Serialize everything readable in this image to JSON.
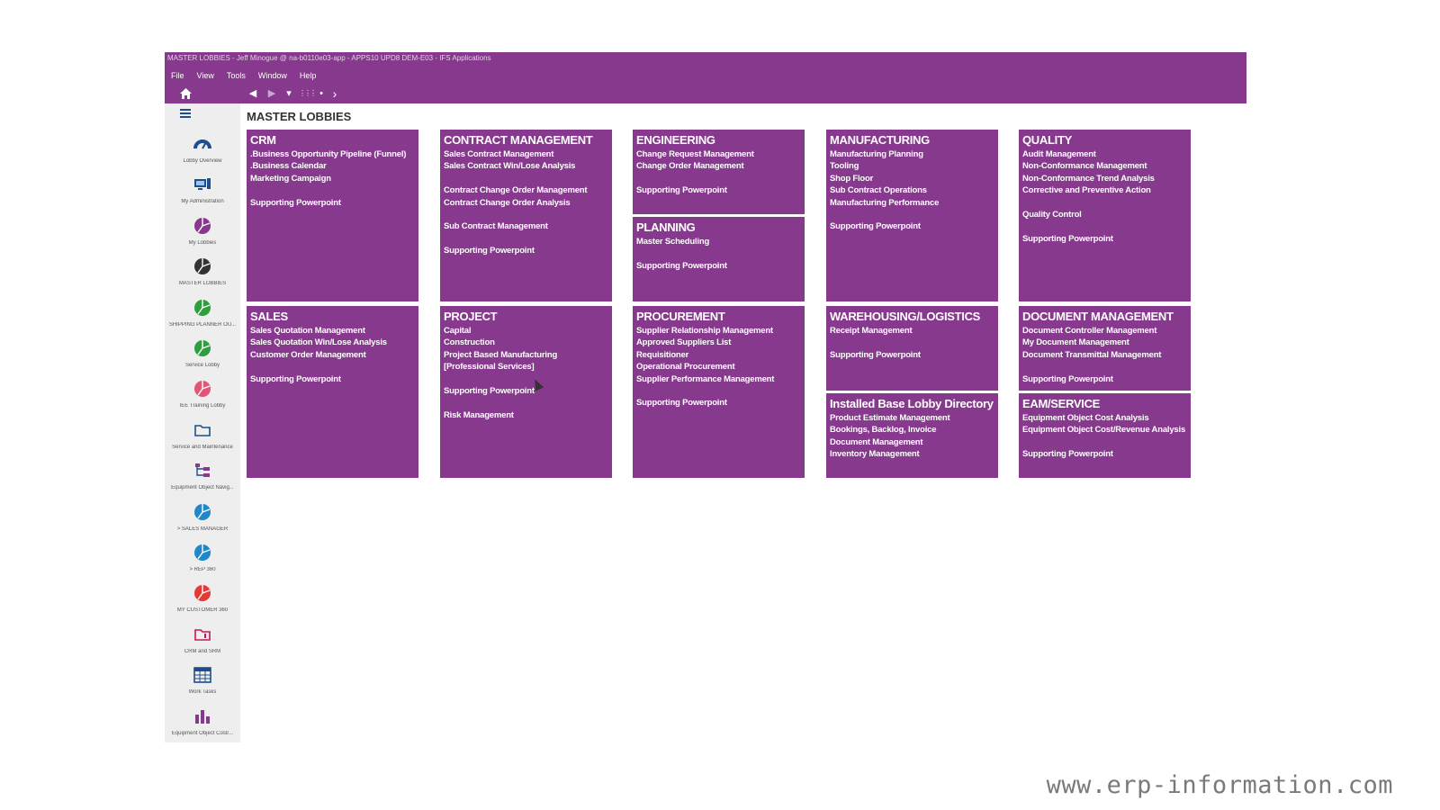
{
  "window": {
    "title": "MASTER LOBBIES - Jeff Minogue @ na-b0110e03-app - APPS10 UPD8 DEM-E03 - IFS Applications"
  },
  "menu": [
    "File",
    "View",
    "Tools",
    "Window",
    "Help"
  ],
  "toolbar": {
    "back": "◀",
    "forward": "▶",
    "dropdown": "▾",
    "apps": "⋮⋮⋮",
    "dot": "•",
    "next": "›"
  },
  "sidebar": {
    "items": [
      {
        "label": "Lobby Overview",
        "icon": "gauge-icon",
        "color": "#1f4e8c"
      },
      {
        "label": "My Administration",
        "icon": "monitor-icon",
        "color": "#1f4e8c"
      },
      {
        "label": "My Lobbies",
        "icon": "pie-chart-icon",
        "color": "#86398d"
      },
      {
        "label": "MASTER LOBBIES",
        "icon": "pie-chart-icon",
        "color": "#333333"
      },
      {
        "label": "SHIPPING PLANNER OU...",
        "icon": "pie-chart-icon",
        "color": "#2e9e3e"
      },
      {
        "label": "Service Lobby",
        "icon": "pie-chart-icon",
        "color": "#2e9e3e"
      },
      {
        "label": "IEE Training Lobby",
        "icon": "pie-chart-icon",
        "color": "#e05578"
      },
      {
        "label": "Service and Maintenance",
        "icon": "folder-icon",
        "color": "#1f4e8c"
      },
      {
        "label": "Equipment Object Navig...",
        "icon": "tree-navigator-icon",
        "color": "#86398d"
      },
      {
        "label": "> SALES MANAGER",
        "icon": "pie-chart-icon",
        "color": "#1e88c9"
      },
      {
        "label": "> REP 360",
        "icon": "pie-chart-icon",
        "color": "#1e88c9"
      },
      {
        "label": "MY CUSTOMER 360",
        "icon": "pie-chart-icon",
        "color": "#e53935"
      },
      {
        "label": "CRM and SRM",
        "icon": "folder-info-icon",
        "color": "#c2185b"
      },
      {
        "label": "Work Tasks",
        "icon": "calendar-grid-icon",
        "color": "#1f4e8c"
      },
      {
        "label": "Equipment Object Cost/...",
        "icon": "bar-chart-icon",
        "color": "#86398d"
      }
    ]
  },
  "page": {
    "title": "MASTER LOBBIES"
  },
  "tiles": [
    {
      "title": "CRM",
      "lines": [
        ".Business Opportunity Pipeline (Funnel)",
        ".Business Calendar",
        "Marketing Campaign",
        "",
        "Supporting Powerpoint"
      ]
    },
    {
      "title": "CONTRACT MANAGEMENT",
      "lines": [
        "Sales Contract Management",
        "Sales Contract Win/Lose Analysis",
        "",
        "Contract Change Order Management",
        "Contract Change Order Analysis",
        "",
        "Sub Contract Management",
        "",
        "Supporting Powerpoint"
      ]
    },
    {
      "title": "ENGINEERING",
      "lines": [
        "Change Request Management",
        "Change Order Management",
        "",
        "Supporting Powerpoint"
      ]
    },
    {
      "title": "PLANNING",
      "lines": [
        "Master Scheduling",
        "",
        "Supporting Powerpoint"
      ]
    },
    {
      "title": "MANUFACTURING",
      "lines": [
        "Manufacturing Planning",
        "Tooling",
        "Shop Floor",
        "Sub Contract Operations",
        "Manufacturing Performance",
        "",
        "Supporting Powerpoint"
      ]
    },
    {
      "title": "QUALITY",
      "lines": [
        "Audit Management",
        "Non-Conformance Management",
        "Non-Conformance Trend Analysis",
        "Corrective and Preventive Action",
        "",
        "Quality Control",
        "",
        "Supporting Powerpoint"
      ]
    },
    {
      "title": "SALES",
      "lines": [
        "Sales Quotation Management",
        "Sales Quotation Win/Lose Analysis",
        "Customer Order Management",
        "",
        "Supporting Powerpoint"
      ]
    },
    {
      "title": "PROJECT",
      "lines": [
        "Capital",
        "Construction",
        "Project Based Manufacturing",
        "[Professional Services]",
        "",
        "Supporting Powerpoint",
        "",
        "Risk Management"
      ]
    },
    {
      "title": "PROCUREMENT",
      "lines": [
        "Supplier Relationship Management",
        "Approved Suppliers List",
        "Requisitioner",
        "Operational Procurement",
        "Supplier Performance Management",
        "",
        "Supporting Powerpoint"
      ]
    },
    {
      "title": "WAREHOUSING/LOGISTICS",
      "lines": [
        "Receipt Management",
        "",
        "Supporting Powerpoint"
      ]
    },
    {
      "title": "Installed Base Lobby Directory",
      "lines": [
        "Product Estimate Management",
        "Bookings, Backlog, Invoice",
        "Document Management",
        "Inventory Management"
      ]
    },
    {
      "title": "DOCUMENT MANAGEMENT",
      "lines": [
        "Document Controller Management",
        "My Document Management",
        "Document Transmittal Management",
        "",
        "Supporting Powerpoint"
      ]
    },
    {
      "title": "EAM/SERVICE",
      "lines": [
        "Equipment Object Cost Analysis",
        "Equipment Object Cost/Revenue Analysis",
        "",
        "Supporting Powerpoint"
      ]
    }
  ],
  "watermark": "www.erp-information.com",
  "colors": {
    "brand": "#86398d",
    "sidebar_bg": "#eeeeee"
  }
}
